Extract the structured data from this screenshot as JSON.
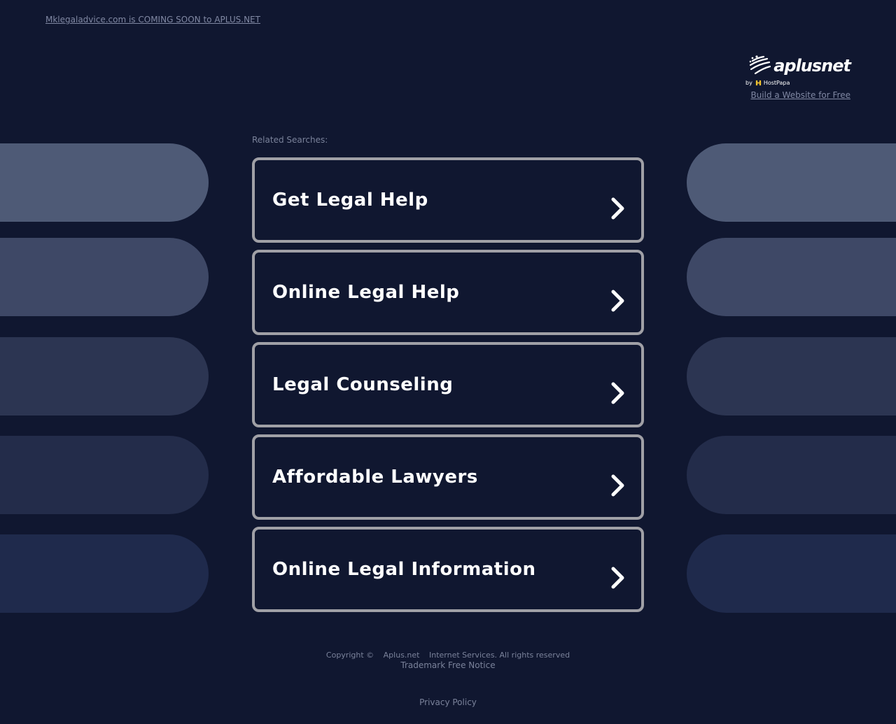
{
  "header": {
    "coming_soon_link": "Mklegaladvice.com is COMING SOON to APLUS.NET"
  },
  "brand": {
    "logo_text": "aplusnet",
    "byline_prefix": "by",
    "byline_company": "HostPapa",
    "build_link": "Build a Website for Free"
  },
  "related": {
    "label": "Related Searches:",
    "items": [
      {
        "label": "Get Legal Help"
      },
      {
        "label": "Online Legal Help"
      },
      {
        "label": "Legal Counseling"
      },
      {
        "label": "Affordable Lawyers"
      },
      {
        "label": "Online Legal Information"
      }
    ]
  },
  "footer": {
    "copyright": "Copyright ©",
    "company": "Aplus.net",
    "services": "Internet Services. All rights reserved",
    "trademark": "Trademark Free Notice",
    "privacy": "Privacy Policy"
  },
  "colors": {
    "background": "#101730",
    "pill_row_1": "#4e5a76",
    "pill_row_2": "#3e4866",
    "pill_row_3": "#2c3552",
    "pill_row_4": "#232c4a",
    "pill_row_5": "#1f2a4c",
    "result_border": "#a0a0a6",
    "muted_text": "#7a829a"
  }
}
